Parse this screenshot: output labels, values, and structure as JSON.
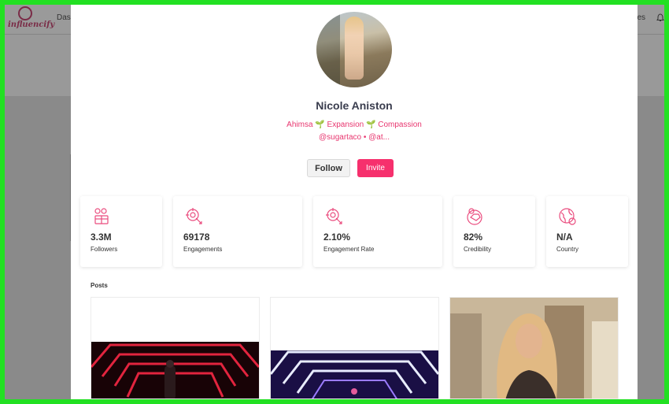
{
  "app": {
    "logo_text": "influencify",
    "nav_partial": "Das",
    "nav_right_partial": "es"
  },
  "profile": {
    "name": "Nicole Aniston",
    "bio": "Ahimsa 🌱 Expansion 🌱 Compassion",
    "handles": "@sugartaco • @at..."
  },
  "actions": {
    "follow_label": "Follow",
    "invite_label": "Invite"
  },
  "stats": [
    {
      "icon": "followers-icon",
      "value": "3.3M",
      "label": "Followers"
    },
    {
      "icon": "engagements-icon",
      "value": "69178",
      "label": "Engagements"
    },
    {
      "icon": "engagement-rate-icon",
      "value": "2.10%",
      "label": "Engagement Rate"
    },
    {
      "icon": "credibility-icon",
      "value": "82%",
      "label": "Credibility"
    },
    {
      "icon": "country-icon",
      "value": "N/A",
      "label": "Country"
    }
  ],
  "posts": {
    "title": "Posts",
    "items": [
      {
        "type": "image",
        "scene": "red neon tunnel"
      },
      {
        "type": "image",
        "scene": "blue neon tunnel"
      },
      {
        "type": "image",
        "scene": "portrait"
      }
    ]
  },
  "colors": {
    "accent": "#f6306d",
    "text_dark": "#3a3d4e",
    "bio_pink": "#e8366f"
  }
}
